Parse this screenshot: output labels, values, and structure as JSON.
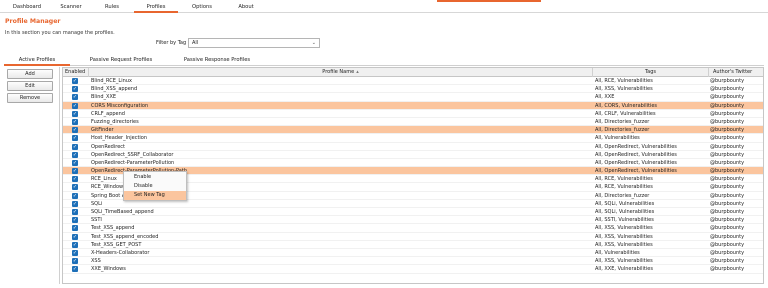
{
  "top_tabs": [
    {
      "label": "Dashboard"
    },
    {
      "label": "Scanner"
    },
    {
      "label": "Rules"
    },
    {
      "label": "Profiles"
    },
    {
      "label": "Options"
    },
    {
      "label": "About"
    }
  ],
  "header": {
    "title": "Profile Manager",
    "description": "In this section you can manage the profiles."
  },
  "filter": {
    "label": "Filter by Tag",
    "value": "All"
  },
  "sub_tabs": [
    {
      "label": "Active Profiles"
    },
    {
      "label": "Passive Request Profiles"
    },
    {
      "label": "Passive Response Profiles"
    }
  ],
  "buttons": {
    "add": "Add",
    "edit": "Edit",
    "remove": "Remove"
  },
  "table": {
    "headers": {
      "enabled": "Enabled",
      "name": "Profile Name",
      "tags": "Tags",
      "author": "Author's Twitter"
    },
    "rows": [
      {
        "name": "Blind_RCE_Linux",
        "tags": "All, RCE, Vulnerabilities",
        "author": "@burpbounty",
        "selected": false
      },
      {
        "name": "Blind_XSS_append",
        "tags": "All, XSS, Vulnerabilities",
        "author": "@burpbounty",
        "selected": false
      },
      {
        "name": "Blind_XXE",
        "tags": "All, XXE",
        "author": "@burpbounty",
        "selected": false
      },
      {
        "name": "CORS Misconfiguration",
        "tags": "All, CORS, Vulnerabilities",
        "author": "@burpbounty",
        "selected": true
      },
      {
        "name": "CRLF_append",
        "tags": "All, CRLF, Vulnerabilities",
        "author": "@burpbounty",
        "selected": false
      },
      {
        "name": "Fuzzing_directories",
        "tags": "All, Directories_fuzzer",
        "author": "@burpbounty",
        "selected": false
      },
      {
        "name": "GitFinder",
        "tags": "All, Directories_fuzzer",
        "author": "@burpbounty",
        "selected": true
      },
      {
        "name": "Host_Header_Injection",
        "tags": "All, Vulnerabilities",
        "author": "@burpbounty",
        "selected": false
      },
      {
        "name": "OpenRedirect",
        "tags": "All, OpenRedirect, Vulnerabilities",
        "author": "@burpbounty",
        "selected": false
      },
      {
        "name": "OpenRedirect_SSRF_Collaborator",
        "tags": "All, OpenRedirect, Vulnerabilities",
        "author": "@burpbounty",
        "selected": false
      },
      {
        "name": "OpenRedirect-ParameterPollution",
        "tags": "All, OpenRedirect, Vulnerabilities",
        "author": "@burpbounty",
        "selected": false
      },
      {
        "name": "OpenRedirect-ParameterPollution-Path",
        "tags": "All, OpenRedirect, Vulnerabilities",
        "author": "@burpbounty",
        "selected": true
      },
      {
        "name": "RCE_Linux",
        "tags": "All, RCE, Vulnerabilities",
        "author": "@burpbounty",
        "selected": false
      },
      {
        "name": "RCE_Windows",
        "tags": "All, RCE, Vulnerabilities",
        "author": "@burpbounty",
        "selected": false
      },
      {
        "name": "Spring Boot Actuator",
        "tags": "All, Directories_fuzzer",
        "author": "@burpbounty",
        "selected": false
      },
      {
        "name": "SQLi",
        "tags": "All, SQLi, Vulnerabilities",
        "author": "@burpbounty",
        "selected": false
      },
      {
        "name": "SQLi_TimeBased_append",
        "tags": "All, SQLi, Vulnerabilities",
        "author": "@burpbounty",
        "selected": false
      },
      {
        "name": "SSTI",
        "tags": "All, SSTI, Vulnerabilities",
        "author": "@burpbounty",
        "selected": false
      },
      {
        "name": "Test_XSS_append",
        "tags": "All, XSS, Vulnerabilities",
        "author": "@burpbounty",
        "selected": false
      },
      {
        "name": "Test_XSS_append_encoded",
        "tags": "All, XSS, Vulnerabilities",
        "author": "@burpbounty",
        "selected": false
      },
      {
        "name": "Test_XSS_GET_POST",
        "tags": "All, XSS, Vulnerabilities",
        "author": "@burpbounty",
        "selected": false
      },
      {
        "name": "X-Headers-Collaborator",
        "tags": "All, Vulnerabilities",
        "author": "@burpbounty",
        "selected": false
      },
      {
        "name": "XSS",
        "tags": "All, XSS, Vulnerabilities",
        "author": "@burpbounty",
        "selected": false
      },
      {
        "name": "XXE_Windows",
        "tags": "All, XXE, Vulnerabilities",
        "author": "@burpbounty",
        "selected": false
      }
    ]
  },
  "context_menu": {
    "items": [
      {
        "label": "Enable",
        "highlighted": false
      },
      {
        "label": "Disable",
        "highlighted": false
      },
      {
        "label": "Set New Tag",
        "highlighted": true
      }
    ]
  },
  "colors": {
    "accent": "#e8662f",
    "selection": "#fbc59e",
    "checkbox": "#1d6fb8"
  },
  "icons": {
    "checkbox": "checkbox-checked-icon",
    "sort": "sort-arrow-icon",
    "dropdown": "chevron-down-icon"
  }
}
